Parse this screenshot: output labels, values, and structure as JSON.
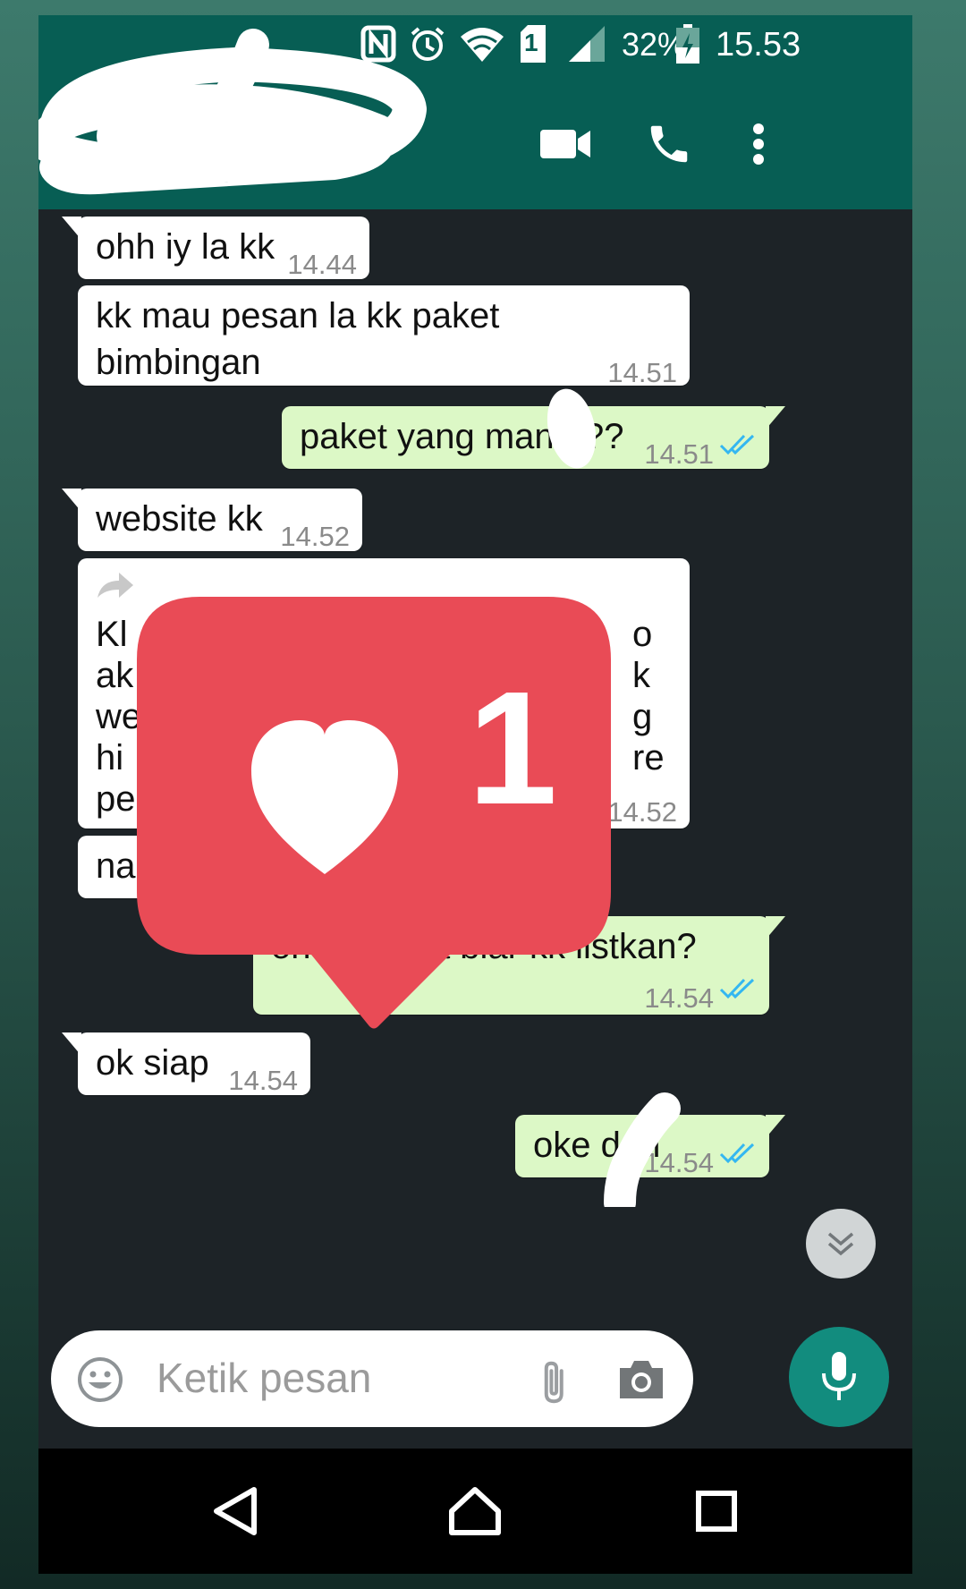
{
  "status_bar": {
    "battery": "32%",
    "time": "15.53",
    "sim": "1",
    "icons": [
      "nfc-icon",
      "alarm-icon",
      "wifi-icon",
      "sim-icon",
      "signal-icon",
      "battery-icon"
    ]
  },
  "app_bar": {
    "actions": [
      "video-call-icon",
      "phone-call-icon",
      "more-vert-icon"
    ]
  },
  "messages": [
    {
      "dir": "in",
      "text": "ohh iy la kk",
      "time": "14.44"
    },
    {
      "dir": "in",
      "text": "kk          mau pesan la kk paket\nbimbingan",
      "time": "14.51"
    },
    {
      "dir": "out",
      "text": "paket yang mana   ??",
      "time": "14.51"
    },
    {
      "dir": "in",
      "text": "website kk",
      "time": "14.52"
    },
    {
      "dir": "in",
      "text": "Kl\nak\nwe\nhi\npe",
      "right_fragments": "o\nk\ng\nre",
      "time": "14.52"
    },
    {
      "dir": "in",
      "text": "nah y",
      "time": ""
    },
    {
      "dir": "out",
      "text": "oh   fix ini ya biar kk listkan?",
      "time": "14.54"
    },
    {
      "dir": "in",
      "text": "ok siap",
      "time": "14.54"
    },
    {
      "dir": "out",
      "text": "oke deh",
      "time": "14.54"
    }
  ],
  "notification": {
    "count": "1",
    "icon": "heart-icon",
    "color": "#e94b56"
  },
  "composer": {
    "placeholder": "Ketik pesan"
  },
  "colors": {
    "header": "#075e54",
    "accent": "#128c7e",
    "outgoing": "#dcf8c6",
    "incoming": "#ffffff",
    "chat_bg": "#1d2327",
    "ticks": "#34b7f1"
  }
}
